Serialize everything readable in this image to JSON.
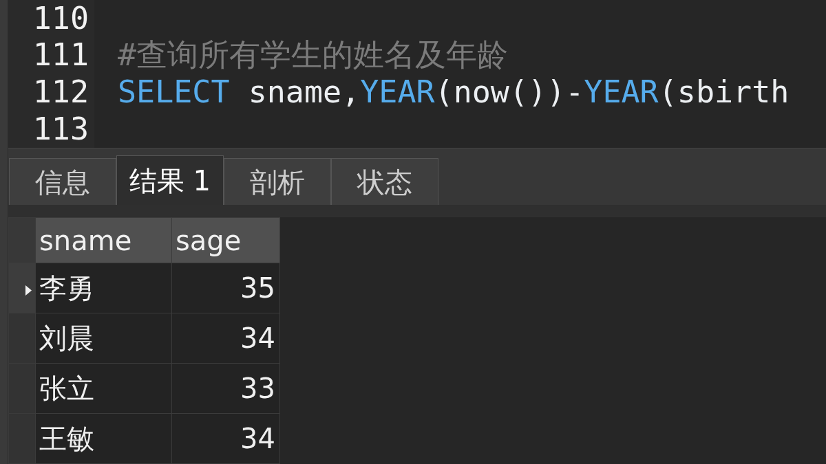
{
  "editor": {
    "lines": [
      {
        "number": "110"
      },
      {
        "number": "111",
        "tokens": [
          {
            "kind": "comment",
            "text": "#查询所有学生的姓名及年龄"
          }
        ]
      },
      {
        "number": "112",
        "tokens": [
          {
            "kind": "keyword",
            "text": "SELECT"
          },
          {
            "kind": "plain",
            "text": " sname,"
          },
          {
            "kind": "function",
            "text": "YEAR"
          },
          {
            "kind": "plain",
            "text": "(now())-"
          },
          {
            "kind": "function",
            "text": "YEAR"
          },
          {
            "kind": "plain",
            "text": "(sbirth"
          }
        ]
      },
      {
        "number": "113"
      }
    ]
  },
  "result_tabs": [
    {
      "label": "信息",
      "selected": false
    },
    {
      "label": "结果 1",
      "selected": true
    },
    {
      "label": "剖析",
      "selected": false
    },
    {
      "label": "状态",
      "selected": false
    }
  ],
  "result_grid": {
    "columns": [
      {
        "label": "sname",
        "kind": "text"
      },
      {
        "label": "sage",
        "kind": "number"
      }
    ],
    "rows": [
      {
        "selected": true,
        "cells": [
          "李勇",
          "35"
        ]
      },
      {
        "selected": false,
        "cells": [
          "刘晨",
          "34"
        ]
      },
      {
        "selected": false,
        "cells": [
          "张立",
          "33"
        ]
      },
      {
        "selected": false,
        "cells": [
          "王敏",
          "34"
        ]
      }
    ]
  }
}
